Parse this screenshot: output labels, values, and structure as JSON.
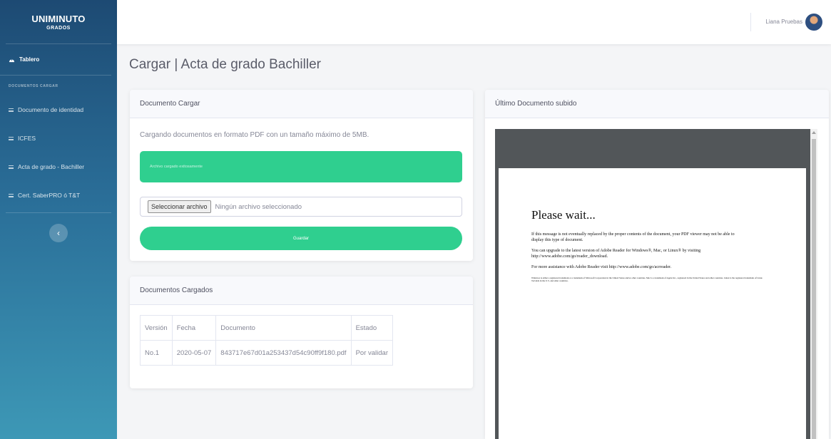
{
  "sidebar": {
    "brand_line1": "UNIMINUTO",
    "brand_line2": "GRADOS",
    "dashboard_label": "Tablero",
    "section_heading": "DOCUMENTOS CARGAR",
    "items": [
      {
        "label": "Documento de identidad"
      },
      {
        "label": "ICFES"
      },
      {
        "label": "Acta de grado - Bachiller"
      },
      {
        "label": "Cert. SaberPRO ó T&T"
      }
    ],
    "toggle_icon": "chevron-left-icon"
  },
  "topbar": {
    "user_name": "Liana Pruebas"
  },
  "page": {
    "title": "Cargar | Acta de grado Bachiller"
  },
  "upload_card": {
    "header": "Documento Cargar",
    "description": "Cargando documentos en formato PDF con un tamaño máximo de 5MB.",
    "alert_text": "Archivo cargado exitosamente",
    "file_button": "Seleccionar archivo",
    "file_none": "Ningún archivo seleccionado",
    "save_button": "Guardar"
  },
  "loaded_card": {
    "header": "Documentos Cargados",
    "columns": [
      "Versión",
      "Fecha",
      "Documento",
      "Estado"
    ],
    "rows": [
      [
        "No.1",
        "2020-05-07",
        "843717e67d01a253437d54c90ff9f180.pdf",
        "Por validar"
      ]
    ]
  },
  "viewer_card": {
    "header": "Último Documento subido",
    "pdf_title": "Please wait...",
    "pdf_p1": "If this message is not eventually replaced by the proper contents of the document, your PDF viewer may not be able to display this type of document.",
    "pdf_p2": "You can upgrade to the latest version of Adobe Reader for Windows®, Mac, or Linux® by visiting http://www.adobe.com/go/reader_download.",
    "pdf_p3": "For more assistance with Adobe Reader visit http://www.adobe.com/go/acrreader.",
    "pdf_p4": "Windows is either a registered trademark or a trademark of Microsoft Corporation in the United States and/or other countries. Mac is a trademark of Apple Inc., registered in the United States and other countries. Linux is the registered trademark of Linus Torvalds in the U.S. and other countries."
  },
  "colors": {
    "sidebar_top": "#1d4a73",
    "sidebar_bottom": "#3d98b6",
    "accent_green": "#2fcf8f",
    "pdf_viewer_bg": "#525659"
  }
}
